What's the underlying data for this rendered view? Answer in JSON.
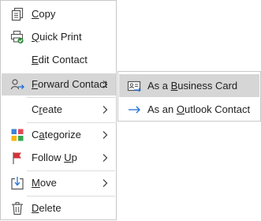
{
  "menu": {
    "items": [
      {
        "label_pre": "",
        "mnemonic": "C",
        "label_post": "opy",
        "icon": "copy-icon"
      },
      {
        "label_pre": "",
        "mnemonic": "Q",
        "label_post": "uick Print",
        "icon": "quick-print-icon"
      },
      {
        "label_pre": "",
        "mnemonic": "E",
        "label_post": "dit Contact",
        "icon": ""
      },
      {
        "label_pre": "",
        "mnemonic": "F",
        "label_post": "orward Contact",
        "icon": "forward-contact-icon",
        "has_submenu": true,
        "highlighted": true
      },
      {
        "label_pre": "C",
        "mnemonic": "r",
        "label_post": "eate",
        "icon": "",
        "has_submenu": true
      },
      {
        "label_pre": "C",
        "mnemonic": "a",
        "label_post": "tegorize",
        "icon": "categorize-icon",
        "has_submenu": true
      },
      {
        "label_pre": "Follow ",
        "mnemonic": "U",
        "label_post": "p",
        "icon": "flag-icon",
        "has_submenu": true
      },
      {
        "label_pre": "",
        "mnemonic": "M",
        "label_post": "ove",
        "icon": "move-icon",
        "has_submenu": true
      },
      {
        "label_pre": "",
        "mnemonic": "D",
        "label_post": "elete",
        "icon": "delete-icon"
      }
    ]
  },
  "submenu": {
    "items": [
      {
        "label_pre": "As a ",
        "mnemonic": "B",
        "label_post": "usiness Card",
        "icon": "business-card-icon",
        "highlighted": true
      },
      {
        "label_pre": "As an ",
        "mnemonic": "O",
        "label_post": "utlook Contact",
        "icon": "arrow-right-icon"
      }
    ]
  },
  "colors": {
    "highlight": "#d6d6d6",
    "border": "#c8c8c8",
    "accent_blue": "#1e6fd9",
    "icon_gray": "#555555",
    "flag_red": "#d13438"
  }
}
